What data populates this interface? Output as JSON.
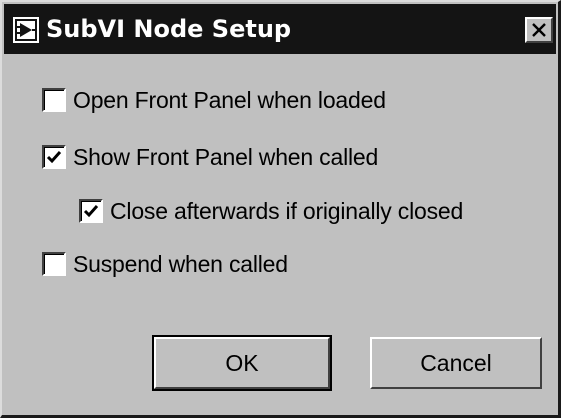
{
  "window": {
    "title": "SubVI Node Setup",
    "app_icon": "labview-vi-icon",
    "close_icon": "close-icon"
  },
  "options": [
    {
      "label": "Open Front Panel when loaded",
      "checked": false
    },
    {
      "label": "Show Front Panel when called",
      "checked": true
    },
    {
      "label": "Close afterwards if originally closed",
      "checked": true
    },
    {
      "label": "Suspend when called",
      "checked": false
    }
  ],
  "buttons": {
    "ok_label": "OK",
    "cancel_label": "Cancel"
  },
  "colors": {
    "titlebar": "#141414",
    "face": "#c0c0c0",
    "title_text": "#ffffff"
  }
}
